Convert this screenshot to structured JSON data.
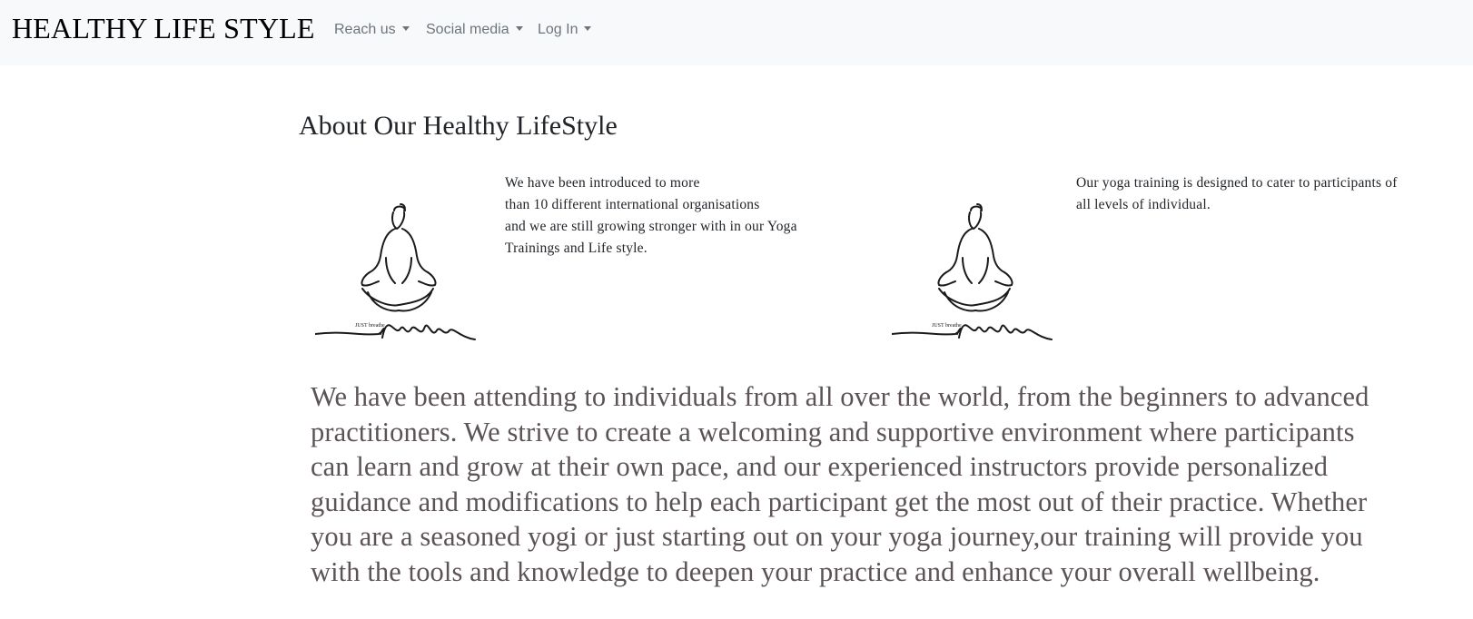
{
  "navbar": {
    "brand": "HEALTHY LIFE STYLE",
    "items": [
      {
        "label": "Reach us"
      },
      {
        "label": "Social media"
      },
      {
        "label": "Log In"
      }
    ]
  },
  "about": {
    "heading": "About Our Healthy LifeStyle",
    "image_caption": "JUST breathe",
    "blocks": [
      {
        "lines": [
          "We have been introduced to more",
          "than 10 different international organisations",
          "and we are still growing stronger with in our Yoga",
          "Trainings and Life style."
        ]
      },
      {
        "lines": [
          "Our yoga training is designed to cater to participants of",
          "all levels of individual."
        ]
      }
    ],
    "body_lines": [
      "We have been attending to individuals from all over the world, from the beginners to advanced",
      "practitioners. We strive to create a welcoming and supportive environment where participants",
      "can learn and grow at their own pace, and our experienced instructors provide personalized",
      "guidance and modifications to help each participant get the most out of their practice. Whether",
      "you are a seasoned yogi or just starting out on your yoga journey,our training will provide you",
      "with the tools and knowledge to deepen your practice and enhance your overall wellbeing."
    ]
  },
  "colors": {
    "navbar_bg": "#f8f9fa",
    "nav_link": "#6c757d",
    "body_text": "#5c5356"
  }
}
